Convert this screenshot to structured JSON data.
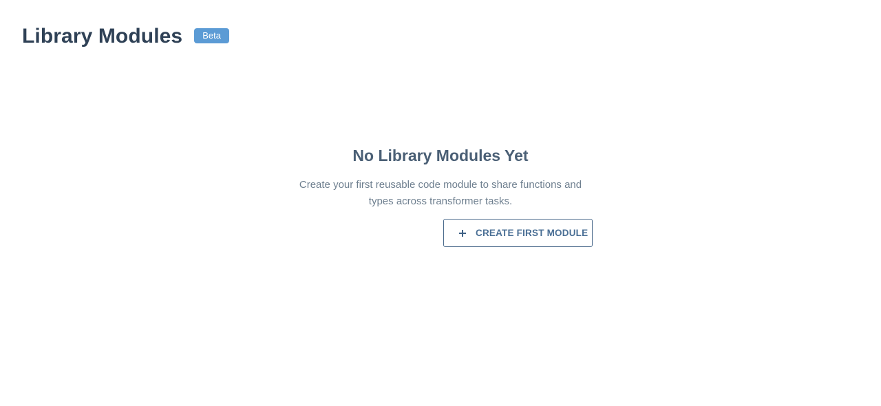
{
  "header": {
    "title": "Library Modules",
    "badge": "Beta"
  },
  "empty_state": {
    "title": "No Library Modules Yet",
    "description": "Create your first reusable code module to share functions and types across transformer tasks.",
    "button_label": "CREATE FIRST MODULE",
    "button_icon": "plus-icon"
  },
  "colors": {
    "title": "#2f4156",
    "badge_bg": "#5b9bd5",
    "button_border": "#4a6a8c",
    "button_text": "#4a6f95"
  }
}
